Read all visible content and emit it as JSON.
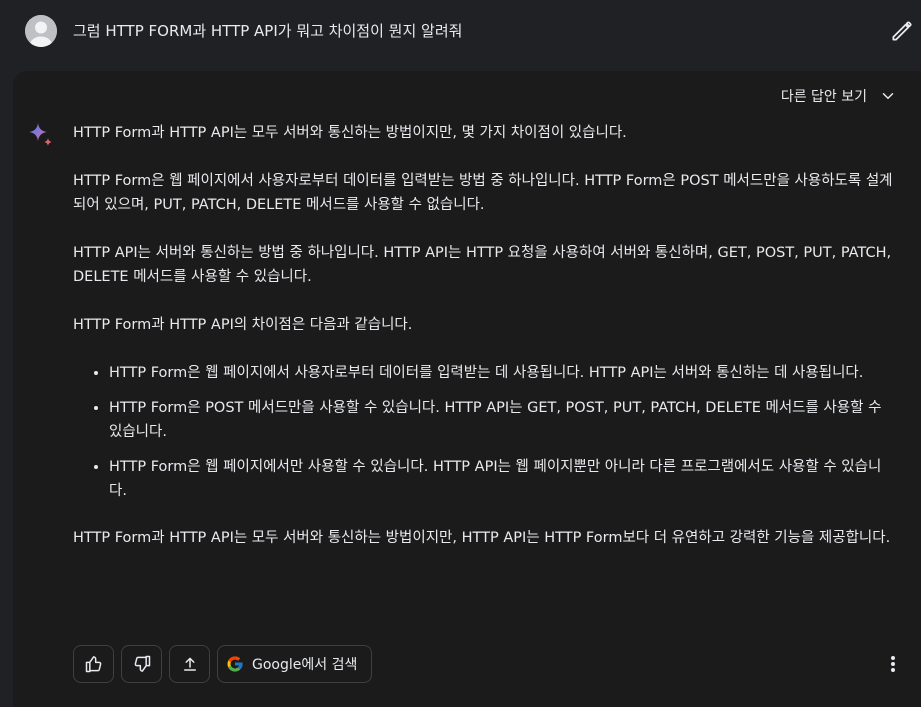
{
  "query": {
    "text": "그럼 HTTP FORM과 HTTP API가 뭐고 차이점이 뭔지 알려줘"
  },
  "drafts": {
    "label": "다른 답안 보기"
  },
  "response": {
    "intro": "HTTP Form과 HTTP API는 모두 서버와 통신하는 방법이지만, 몇 가지 차이점이 있습니다.",
    "paragraph_form": "HTTP Form은 웹 페이지에서 사용자로부터 데이터를 입력받는 방법 중 하나입니다. HTTP Form은 POST 메서드만을 사용하도록 설계되어 있으며, PUT, PATCH, DELETE 메서드를 사용할 수 없습니다.",
    "paragraph_api": "HTTP API는 서버와 통신하는 방법 중 하나입니다. HTTP API는 HTTP 요청을 사용하여 서버와 통신하며, GET, POST, PUT, PATCH, DELETE 메서드를 사용할 수 있습니다.",
    "diff_heading": "HTTP Form과 HTTP API의 차이점은 다음과 같습니다.",
    "bullets": [
      "HTTP Form은 웹 페이지에서 사용자로부터 데이터를 입력받는 데 사용됩니다. HTTP API는 서버와 통신하는 데 사용됩니다.",
      "HTTP Form은 POST 메서드만을 사용할 수 있습니다. HTTP API는 GET, POST, PUT, PATCH, DELETE 메서드를 사용할 수 있습니다.",
      "HTTP Form은 웹 페이지에서만 사용할 수 있습니다. HTTP API는 웹 페이지뿐만 아니라 다른 프로그램에서도 사용할 수 있습니다."
    ],
    "conclusion": "HTTP Form과 HTTP API는 모두 서버와 통신하는 방법이지만, HTTP API는 HTTP Form보다 더 유연하고 강력한 기능을 제공합니다."
  },
  "actions": {
    "google_label": "Google에서 검색"
  },
  "colors": {
    "background": "#202124",
    "card": "#1b1b1c",
    "text": "#e8eaed",
    "border": "#3c4043",
    "spark_blue": "#4285f4",
    "spark_red": "#d96570"
  },
  "icons": [
    "user-avatar-icon",
    "edit-pencil-icon",
    "chevron-down-icon",
    "gemini-sparkle-icon",
    "thumbs-up-icon",
    "thumbs-down-icon",
    "share-icon",
    "google-g-icon",
    "more-vert-icon"
  ]
}
